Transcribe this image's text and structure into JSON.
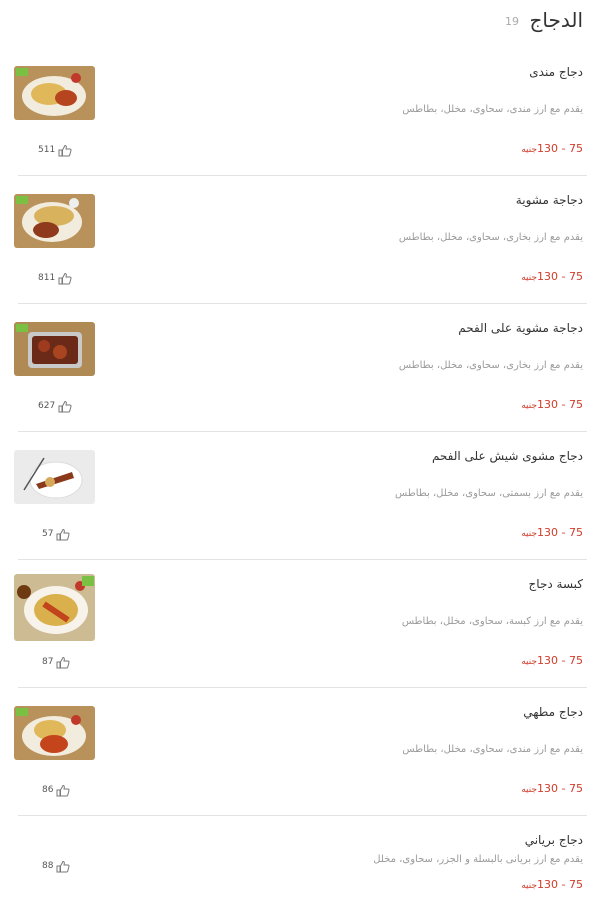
{
  "category": {
    "title": "الدجاج",
    "count": "19"
  },
  "items": [
    {
      "name": "دجاج مندى",
      "desc": "يقدم مع ارز مندى، سحاوى، مخلل، بطاطس",
      "price": "75 - 130",
      "currency": "جنيه",
      "likes": "511",
      "thumb_icon": "plate-icon"
    },
    {
      "name": "دجاجة مشوية",
      "desc": "يقدم مع ارز بخارى، سحاوى، مخلل، بطاطس",
      "price": "75 - 130",
      "currency": "جنيه",
      "likes": "811",
      "thumb_icon": "plate-icon"
    },
    {
      "name": "دجاجة مشوية على الفحم",
      "desc": "يقدم مع ارز بخارى، سحاوى، مخلل، بطاطس",
      "price": "75 - 130",
      "currency": "جنيه",
      "likes": "627",
      "thumb_icon": "tray-icon"
    },
    {
      "name": "دجاج مشوى شيش على الفحم",
      "desc": "يقدم مع ارز بسمتى، سحاوى، مخلل، بطاطس",
      "price": "75 - 130",
      "currency": "جنيه",
      "likes": "57",
      "thumb_icon": "plate-icon"
    },
    {
      "name": "كبسة دجاج",
      "desc": "يقدم مع ارز كبسة، سحاوى، مخلل، بطاطس",
      "price": "75 - 130",
      "currency": "جنيه",
      "likes": "87",
      "thumb_icon": "plate-icon"
    },
    {
      "name": "دجاج مطهي",
      "desc": "يقدم مع ارز مندى، سحاوى، مخلل، بطاطس",
      "price": "75 - 130",
      "currency": "جنيه",
      "likes": "86",
      "thumb_icon": "plate-icon"
    },
    {
      "name": "دجاج برياني",
      "desc": "يقدم مع ارز بريانى بالبسلة و الجزر، سحاوى، مخلل",
      "price": "75 - 130",
      "currency": "جنيه",
      "likes": "88",
      "thumb_icon": ""
    }
  ],
  "colors": {
    "price": "#d23a2a",
    "divider": "#e3e3e3",
    "thumb_bg": "#b8925a"
  }
}
